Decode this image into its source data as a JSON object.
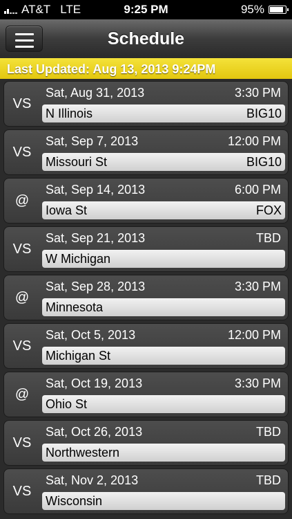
{
  "status": {
    "carrier": "AT&T",
    "network": "LTE",
    "time": "9:25 PM",
    "battery": "95%",
    "battery_level": 0.95
  },
  "nav": {
    "title": "Schedule",
    "menu_icon": "hamburger-menu-icon"
  },
  "banner": {
    "text": "Last Updated: Aug 13, 2013 9:24PM",
    "color": "#f0d82a"
  },
  "games": [
    {
      "venue": "VS",
      "date": "Sat, Aug 31, 2013",
      "time": "3:30 PM",
      "opponent": "N Illinois",
      "tv": "BIG10"
    },
    {
      "venue": "VS",
      "date": "Sat, Sep 7, 2013",
      "time": "12:00 PM",
      "opponent": "Missouri St",
      "tv": "BIG10"
    },
    {
      "venue": "@",
      "date": "Sat, Sep 14, 2013",
      "time": "6:00 PM",
      "opponent": "Iowa St",
      "tv": "FOX"
    },
    {
      "venue": "VS",
      "date": "Sat, Sep 21, 2013",
      "time": "TBD",
      "opponent": "W Michigan",
      "tv": ""
    },
    {
      "venue": "@",
      "date": "Sat, Sep 28, 2013",
      "time": "3:30 PM",
      "opponent": "Minnesota",
      "tv": ""
    },
    {
      "venue": "VS",
      "date": "Sat, Oct 5, 2013",
      "time": "12:00 PM",
      "opponent": "Michigan St",
      "tv": ""
    },
    {
      "venue": "@",
      "date": "Sat, Oct 19, 2013",
      "time": "3:30 PM",
      "opponent": "Ohio St",
      "tv": ""
    },
    {
      "venue": "VS",
      "date": "Sat, Oct 26, 2013",
      "time": "TBD",
      "opponent": "Northwestern",
      "tv": ""
    },
    {
      "venue": "VS",
      "date": "Sat, Nov 2, 2013",
      "time": "TBD",
      "opponent": "Wisconsin",
      "tv": ""
    }
  ]
}
